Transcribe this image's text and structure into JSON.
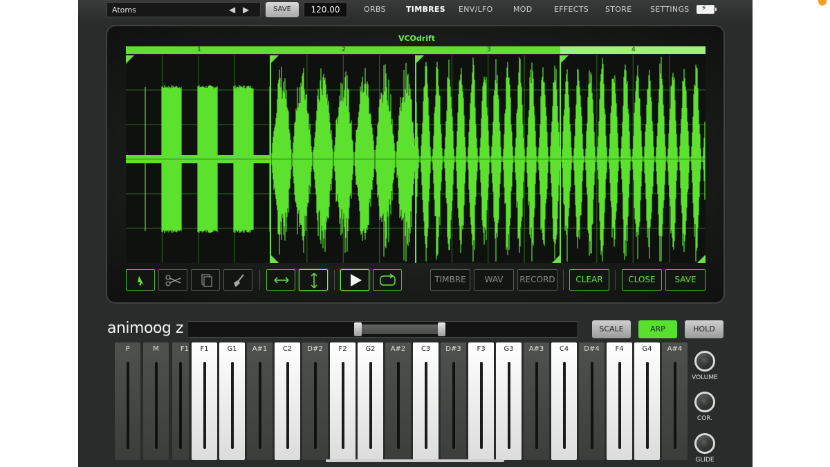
{
  "topbar": {
    "preset_name": "Atoms",
    "save_label": "SAVE",
    "tempo": "120.00",
    "tabs": [
      "ORBS",
      "TIMBRES",
      "ENV/LFO",
      "MOD",
      "EFFECTS",
      "STORE",
      "SETTINGS"
    ],
    "active_tab": "TIMBRES",
    "battery_icon": "battery-charging-icon"
  },
  "editor": {
    "title": "VCOdrift",
    "bar_numbers": [
      "1",
      "2",
      "3",
      "4"
    ],
    "wave_color": "#5ce12f",
    "tools": {
      "select_icon": "pointer-icon",
      "cut_icon": "scissors-icon",
      "copy_icon": "copy-icon",
      "clear_icon": "brush-icon",
      "h_stretch_icon": "horizontal-arrows-icon",
      "v_stretch_icon": "vertical-arrows-icon",
      "play_icon": "play-icon",
      "loop_icon": "loop-icon",
      "timbre_label": "TIMBRE",
      "wav_label": "WAV",
      "record_label": "RECORD",
      "clear_label": "CLEAR",
      "close_label": "CLOSE",
      "save_label": "SAVE"
    }
  },
  "keyboard": {
    "logo": "animoog z",
    "scale_label": "SCALE",
    "arp_label": "ARP",
    "hold_label": "HOLD",
    "accent": "#58e02f",
    "strips": [
      "P",
      "M"
    ],
    "partial_key": "F1",
    "keys": [
      {
        "label": "F1",
        "type": "white"
      },
      {
        "label": "G1",
        "type": "white"
      },
      {
        "label": "A#1",
        "type": "black"
      },
      {
        "label": "C2",
        "type": "white"
      },
      {
        "label": "D#2",
        "type": "black"
      },
      {
        "label": "F2",
        "type": "white"
      },
      {
        "label": "G2",
        "type": "white"
      },
      {
        "label": "A#2",
        "type": "black"
      },
      {
        "label": "C3",
        "type": "white"
      },
      {
        "label": "D#3",
        "type": "black"
      },
      {
        "label": "F3",
        "type": "white"
      },
      {
        "label": "G3",
        "type": "white"
      },
      {
        "label": "A#3",
        "type": "black"
      },
      {
        "label": "C4",
        "type": "white"
      },
      {
        "label": "D#4",
        "type": "black"
      },
      {
        "label": "F4",
        "type": "white"
      },
      {
        "label": "G4",
        "type": "white"
      },
      {
        "label": "A#4",
        "type": "black"
      }
    ],
    "knobs": [
      "VOLUME",
      "COR.",
      "GLIDE"
    ]
  }
}
